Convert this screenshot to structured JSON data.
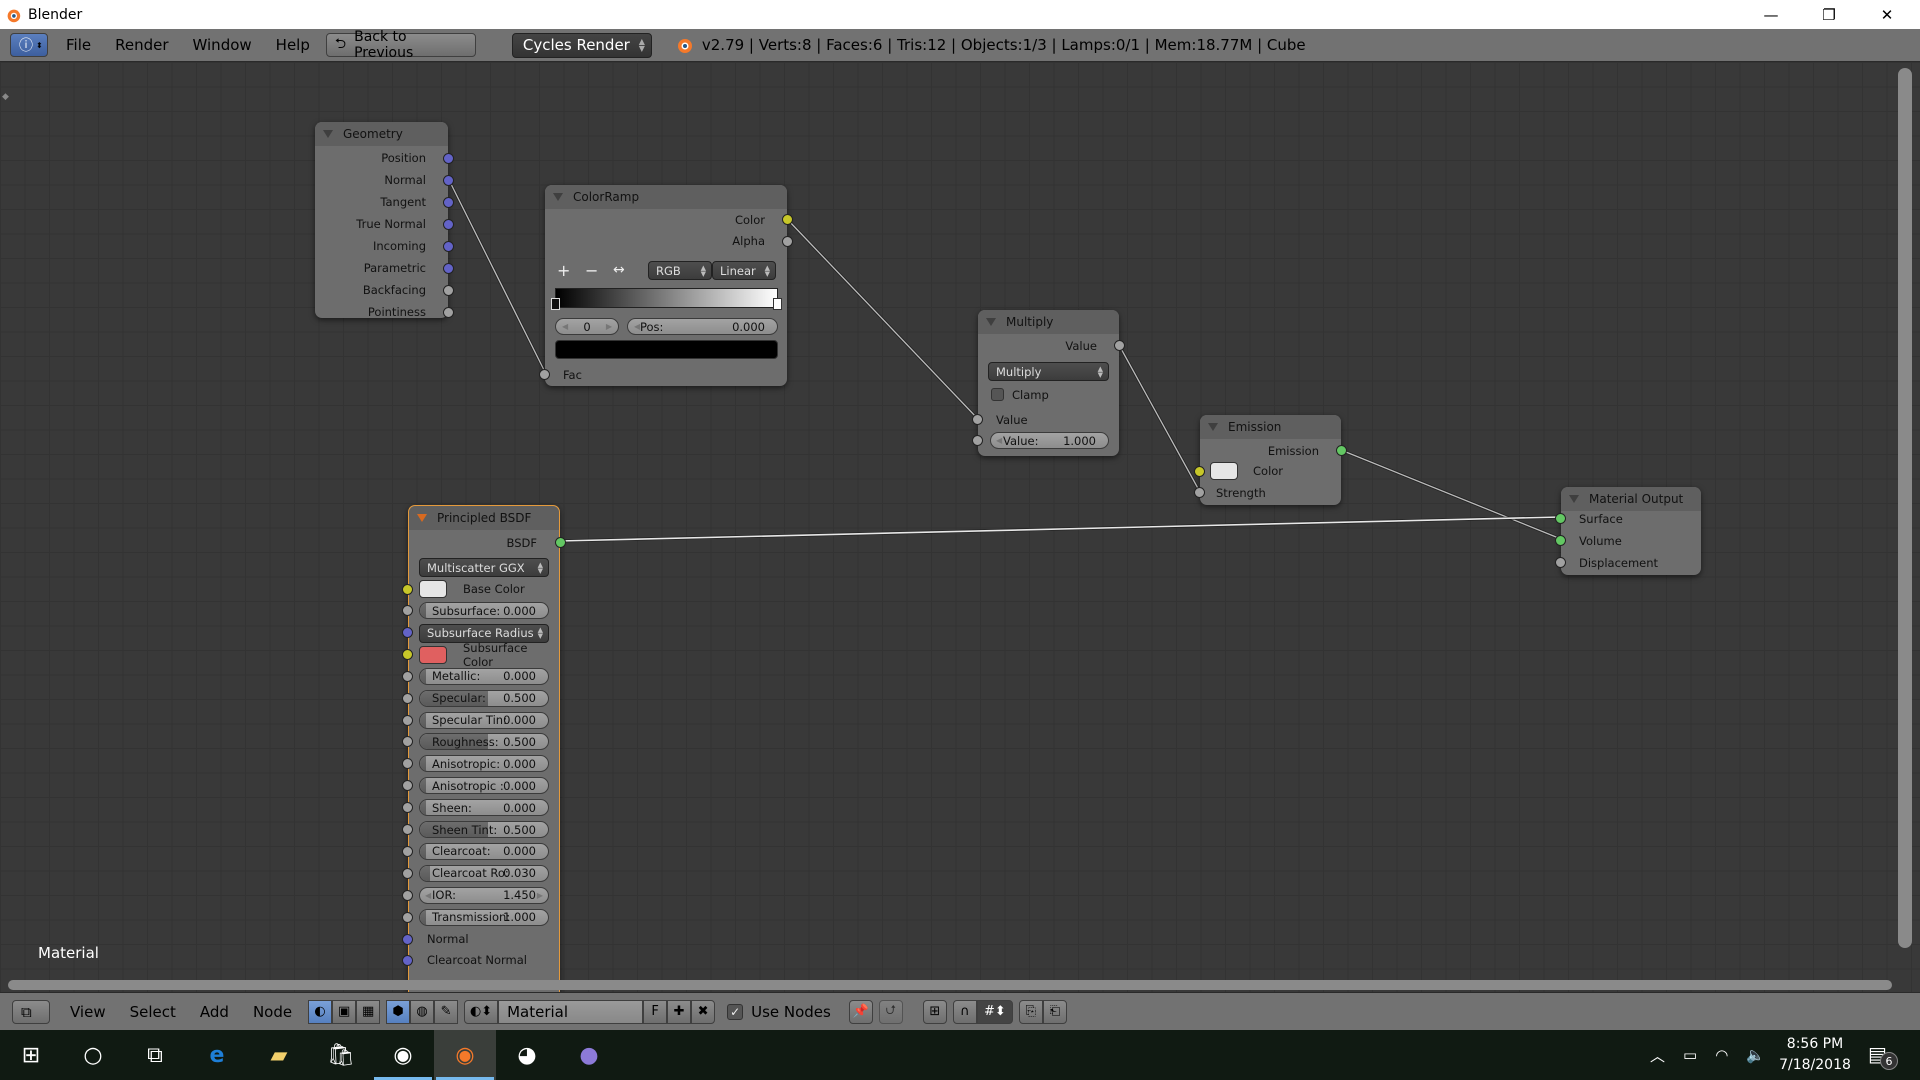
{
  "window": {
    "title": "Blender",
    "controls": [
      "minimize",
      "restore",
      "close"
    ]
  },
  "header": {
    "menus": [
      "File",
      "Render",
      "Window",
      "Help"
    ],
    "back_button": "Back to Previous",
    "render_engine": "Cycles Render",
    "stats": "v2.79 | Verts:8 | Faces:6 | Tris:12 | Objects:1/3 | Lamps:0/1 | Mem:18.77M | Cube"
  },
  "nodes": {
    "geometry": {
      "title": "Geometry",
      "outputs": [
        {
          "label": "Position",
          "type": "vector"
        },
        {
          "label": "Normal",
          "type": "vector"
        },
        {
          "label": "Tangent",
          "type": "vector"
        },
        {
          "label": "True Normal",
          "type": "vector"
        },
        {
          "label": "Incoming",
          "type": "vector"
        },
        {
          "label": "Parametric",
          "type": "vector"
        },
        {
          "label": "Backfacing",
          "type": "float"
        },
        {
          "label": "Pointiness",
          "type": "float"
        }
      ]
    },
    "colorramp": {
      "title": "ColorRamp",
      "outputs": [
        "Color",
        "Alpha"
      ],
      "tools": [
        "+",
        "−",
        "↔"
      ],
      "color_mode": "RGB",
      "interpolation": "Linear",
      "active_stop": "0",
      "pos_label": "Pos:",
      "pos_value": "0.000",
      "stop_color": "#000000",
      "input": "Fac"
    },
    "multiply": {
      "title": "Multiply",
      "output": "Value",
      "operation": "Multiply",
      "clamp_label": "Clamp",
      "clamp_checked": false,
      "input_value_label": "Value",
      "value_field_label": "Value:",
      "value_field_value": "1.000"
    },
    "emission": {
      "title": "Emission",
      "output": "Emission",
      "color_label": "Color",
      "color": "#e6e6e6",
      "strength_label": "Strength"
    },
    "material_output": {
      "title": "Material Output",
      "inputs": [
        "Surface",
        "Volume",
        "Displacement"
      ]
    },
    "principled": {
      "title": "Principled BSDF",
      "output": "BSDF",
      "distribution": "Multiscatter GGX",
      "base_color_label": "Base Color",
      "base_color": "#e6e6e6",
      "subsurface_radius": "Subsurface Radius",
      "subsurface_color_label": "Subsurface Color",
      "subsurface_color": "#e06060",
      "fields": [
        {
          "label": "Subsurface:",
          "value": "0.000",
          "fraction": 0.0
        },
        {
          "label": "Metallic:",
          "value": "0.000",
          "fraction": 0.0
        },
        {
          "label": "Specular:",
          "value": "0.500",
          "fraction": 0.5
        },
        {
          "label": "Specular Tin:",
          "value": "0.000",
          "fraction": 0.0
        },
        {
          "label": "Roughness:",
          "value": "0.500",
          "fraction": 0.5
        },
        {
          "label": "Anisotropic:",
          "value": "0.000",
          "fraction": 0.0
        },
        {
          "label": "Anisotropic :",
          "value": "0.000",
          "fraction": 0.0
        },
        {
          "label": "Sheen:",
          "value": "0.000",
          "fraction": 0.0
        },
        {
          "label": "Sheen Tint:",
          "value": "0.500",
          "fraction": 0.5
        },
        {
          "label": "Clearcoat:",
          "value": "0.000",
          "fraction": 0.0
        },
        {
          "label": "Clearcoat Ro:",
          "value": "0.030",
          "fraction": 0.03
        },
        {
          "label": "IOR:",
          "value": "1.450",
          "fraction": null
        },
        {
          "label": "Transmission:",
          "value": "1.000",
          "fraction": 0.0
        }
      ],
      "vector_inputs": [
        "Normal",
        "Clearcoat Normal"
      ]
    }
  },
  "editor": {
    "material_label": "Material"
  },
  "footer": {
    "menus": [
      "View",
      "Select",
      "Add",
      "Node"
    ],
    "material_name": "Material",
    "fake_user": "F",
    "use_nodes_label": "Use Nodes",
    "use_nodes_checked": true
  },
  "taskbar": {
    "apps": [
      "start",
      "cortana-search",
      "task-view",
      "edge",
      "file-explorer",
      "store",
      "chrome",
      "blender",
      "bee-app",
      "bittorrent"
    ],
    "time": "8:56 PM",
    "date": "7/18/2018",
    "notifications": "6"
  },
  "colors": {
    "socket_vector": "#6363c7",
    "socket_float": "#a1a1a1",
    "socket_color": "#c7c729",
    "socket_shader": "#63c763",
    "active_node": "#e59a3b"
  }
}
